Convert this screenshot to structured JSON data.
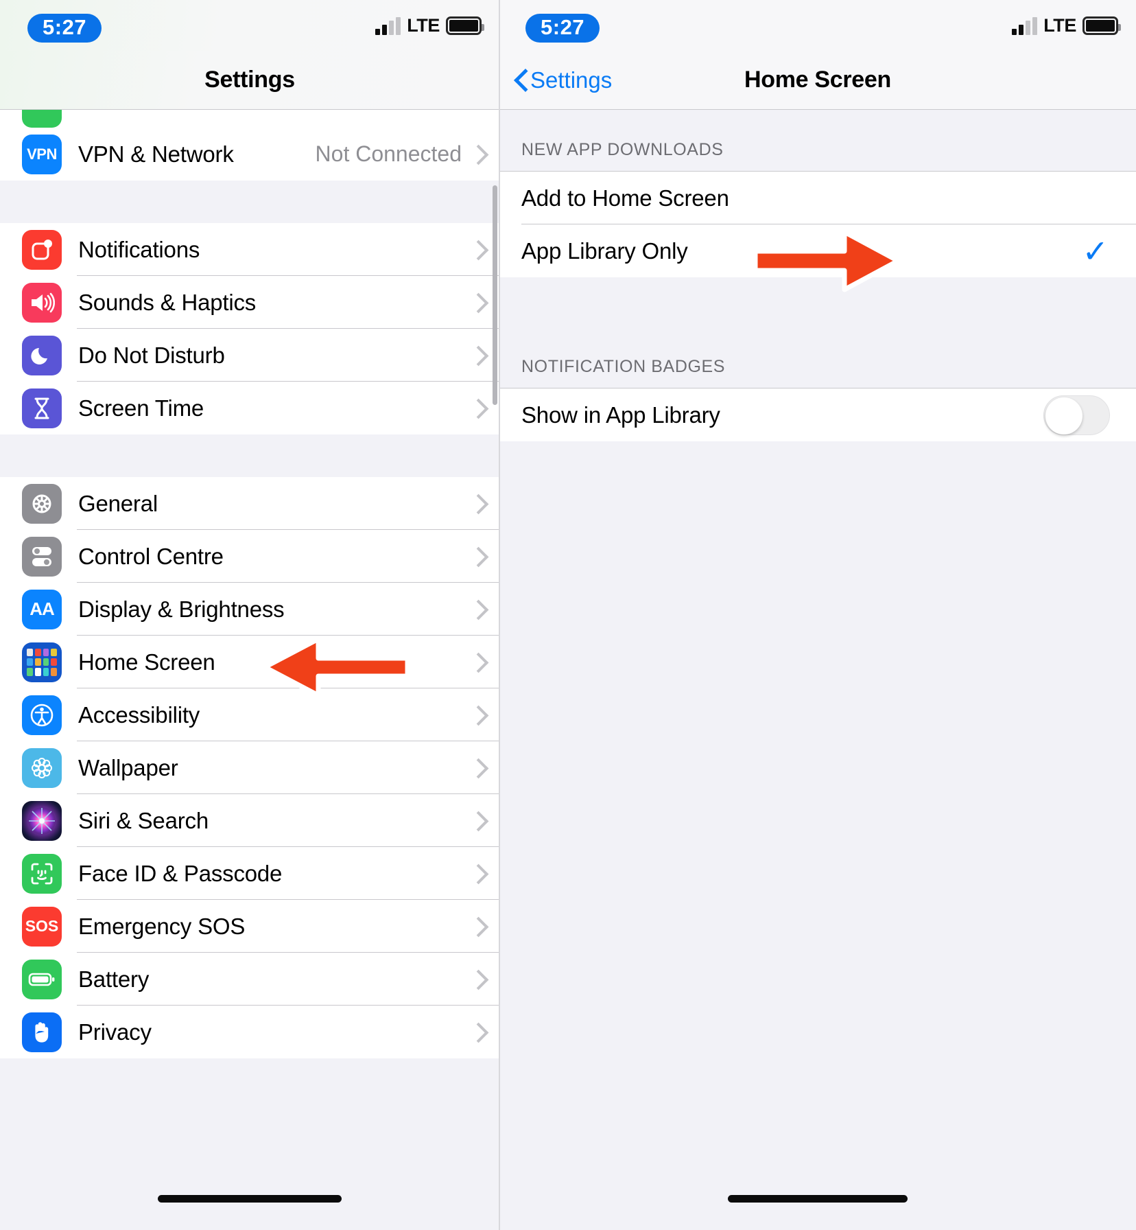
{
  "left": {
    "status": {
      "time": "5:27",
      "network": "LTE"
    },
    "nav": {
      "title": "Settings"
    },
    "groups": [
      {
        "rows": [
          {
            "label": "VPN & Network",
            "icon": "vpn-icon",
            "value": "Not Connected",
            "chevron": true
          }
        ]
      },
      {
        "rows": [
          {
            "label": "Notifications",
            "icon": "notifications-icon",
            "value": "",
            "chevron": true
          },
          {
            "label": "Sounds & Haptics",
            "icon": "sounds-icon",
            "value": "",
            "chevron": true
          },
          {
            "label": "Do Not Disturb",
            "icon": "do-not-disturb-icon",
            "value": "",
            "chevron": true
          },
          {
            "label": "Screen Time",
            "icon": "screen-time-icon",
            "value": "",
            "chevron": true
          }
        ]
      },
      {
        "rows": [
          {
            "label": "General",
            "icon": "general-gear-icon",
            "value": "",
            "chevron": true
          },
          {
            "label": "Control Centre",
            "icon": "control-centre-icon",
            "value": "",
            "chevron": true
          },
          {
            "label": "Display & Brightness",
            "icon": "display-brightness-icon",
            "value": "",
            "chevron": true
          },
          {
            "label": "Home Screen",
            "icon": "home-screen-icon",
            "value": "",
            "chevron": true
          },
          {
            "label": "Accessibility",
            "icon": "accessibility-icon",
            "value": "",
            "chevron": true
          },
          {
            "label": "Wallpaper",
            "icon": "wallpaper-icon",
            "value": "",
            "chevron": true
          },
          {
            "label": "Siri & Search",
            "icon": "siri-icon",
            "value": "",
            "chevron": true
          },
          {
            "label": "Face ID & Passcode",
            "icon": "face-id-icon",
            "value": "",
            "chevron": true
          },
          {
            "label": "Emergency SOS",
            "icon": "sos-icon",
            "value": "",
            "chevron": true
          },
          {
            "label": "Battery",
            "icon": "battery-icon",
            "value": "",
            "chevron": true
          },
          {
            "label": "Privacy",
            "icon": "privacy-hand-icon",
            "value": "",
            "chevron": true
          }
        ]
      }
    ]
  },
  "right": {
    "status": {
      "time": "5:27",
      "network": "LTE"
    },
    "nav": {
      "back_label": "Settings",
      "title": "Home Screen"
    },
    "sections": [
      {
        "header": "NEW APP DOWNLOADS",
        "rows": [
          {
            "label": "Add to Home Screen",
            "selected": false
          },
          {
            "label": "App Library Only",
            "selected": true
          }
        ]
      },
      {
        "header": "NOTIFICATION BADGES",
        "rows": [
          {
            "label": "Show in App Library",
            "toggle": "off"
          }
        ]
      }
    ]
  },
  "annotations": {
    "arrow_color": "#f04018",
    "arrow_left_target": "Home Screen",
    "arrow_right_target": "App Library Only"
  }
}
